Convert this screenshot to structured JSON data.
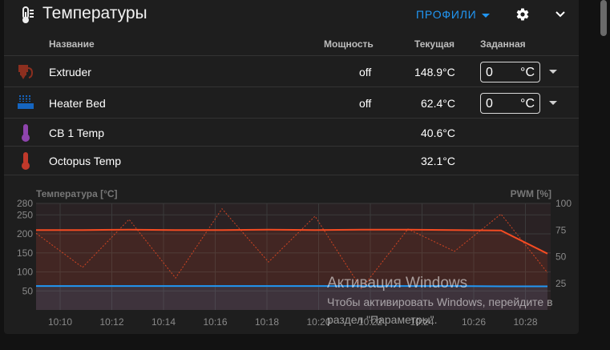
{
  "header": {
    "title": "Температуры",
    "profiles_label": "ПРОФИЛИ",
    "icons": {
      "title": "thermometer-icon",
      "settings": "gear-icon",
      "collapse": "chevron-up-icon"
    }
  },
  "table": {
    "columns": [
      "Название",
      "Мощность",
      "Текущая",
      "Заданная"
    ],
    "rows": [
      {
        "name": "Extruder",
        "power": "off",
        "current": "148.9°C",
        "target_value": "0",
        "target_unit": "°C",
        "icon": "extruder-icon",
        "icon_color": "#8c2f1f"
      },
      {
        "name": "Heater Bed",
        "power": "off",
        "current": "62.4°C",
        "target_value": "0",
        "target_unit": "°C",
        "icon": "heater-bed-icon",
        "icon_color": "#1565c0"
      },
      {
        "name": "CB 1 Temp",
        "power": "",
        "current": "40.6°C",
        "icon": "thermometer-icon",
        "icon_color": "#8e44ad"
      },
      {
        "name": "Octopus Temp",
        "power": "",
        "current": "32.1°C",
        "icon": "thermometer-icon",
        "icon_color": "#c0392b"
      }
    ]
  },
  "chart_data": {
    "type": "line",
    "ylabel": "Температура [°C]",
    "y2label": "PWM [%]",
    "ylim": [
      0,
      280
    ],
    "yticks": [
      50,
      100,
      150,
      200,
      250,
      280
    ],
    "y2lim": [
      0,
      100
    ],
    "y2ticks": [
      25,
      50,
      75,
      100
    ],
    "x": [
      "10:10",
      "10:12",
      "10:14",
      "10:16",
      "10:18",
      "10:20",
      "10:22",
      "10:24",
      "10:26",
      "10:28"
    ],
    "grid": true,
    "series": [
      {
        "color": "#f44b22",
        "values": [
          210,
          210,
          211,
          210,
          210,
          211,
          210,
          211,
          211,
          210,
          209,
          148
        ]
      },
      {
        "color": "#2196f3",
        "values": [
          63,
          63,
          63,
          63,
          63,
          63,
          63,
          63,
          63,
          63,
          62,
          62
        ]
      }
    ],
    "pwm_series": {
      "color": "#f44b22",
      "style": "dotted",
      "values": [
        72,
        40,
        85,
        30,
        95,
        45,
        88,
        20,
        76,
        55,
        90,
        35
      ]
    }
  },
  "os_overlay": {
    "title": "Активация Windows",
    "line1": "Чтобы активировать Windows, перейдите в",
    "line2": "раздел \"Параметры\"."
  }
}
